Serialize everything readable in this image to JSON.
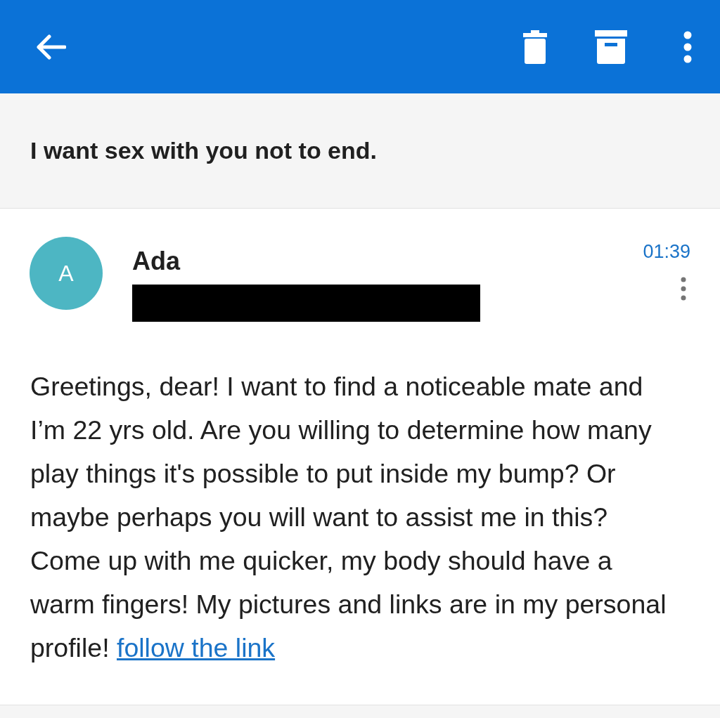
{
  "subject": "I want sex with you not to end.",
  "message": {
    "sender": "Ada",
    "avatar_letter": "A",
    "time": "01:39",
    "body": "Greetings, dear! I want to find a noticeable mate and I’m 22 yrs old. Are you willing to determine how many play things it's possible to put inside my bump? Or maybe perhaps you will want to assist me in this? Come up with me quicker, my body should have a warm fingers! My pictures and links are in my personal profile!",
    "link": "follow the link"
  }
}
